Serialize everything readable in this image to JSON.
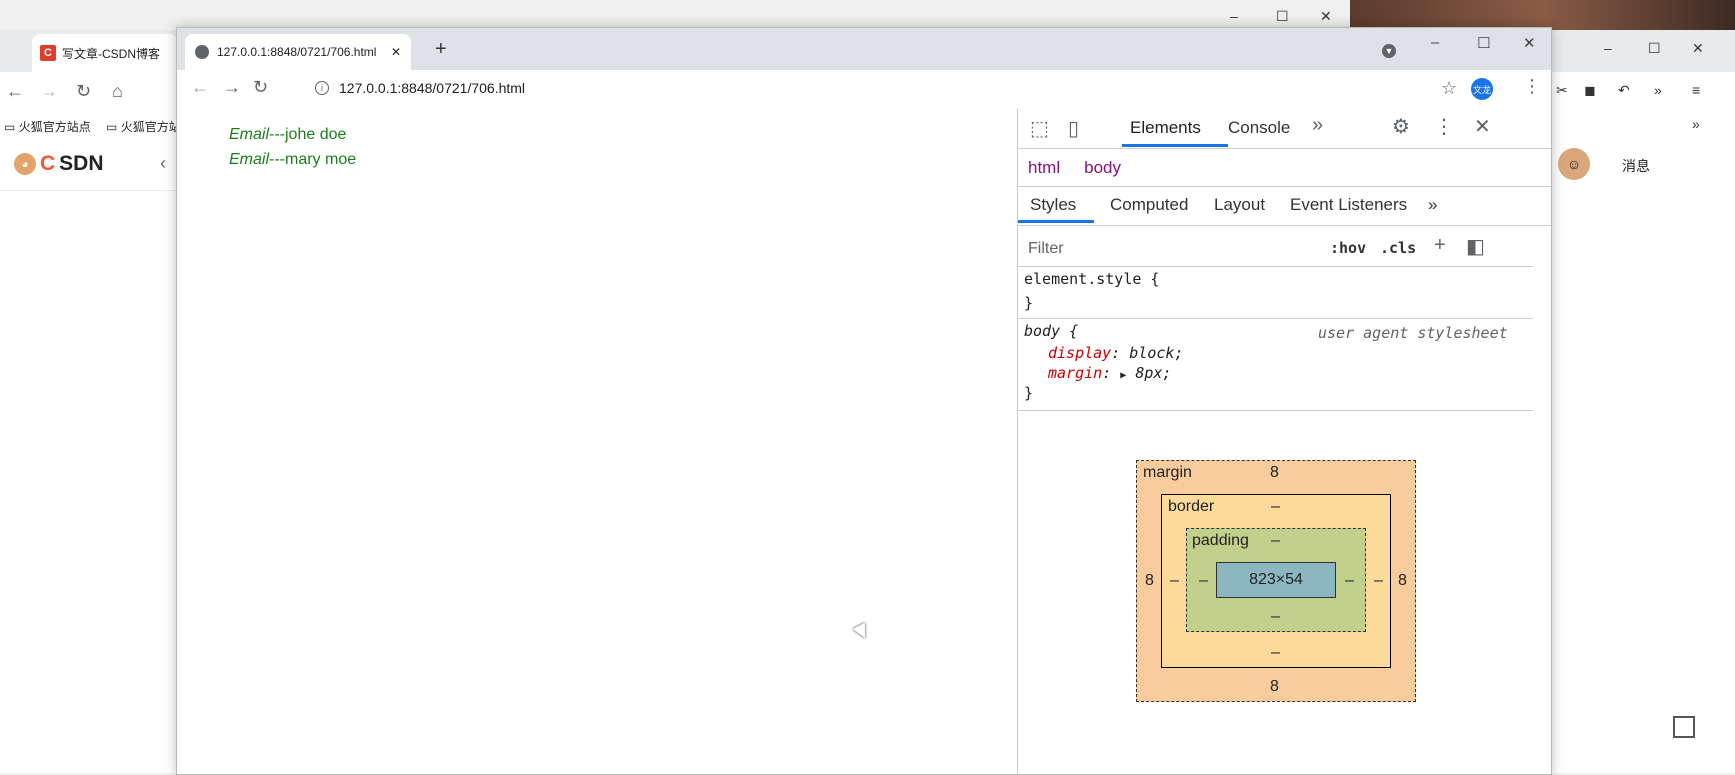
{
  "background_browser": {
    "tab_title": "写文章-CSDN博客",
    "tab_favicon": "C",
    "bookmarks": [
      "火狐官方站点",
      "火狐官方站"
    ],
    "logo": {
      "c": "C",
      "rest": "SDN"
    },
    "right": {
      "profile_initials": "文龙",
      "messages_label": "消息"
    }
  },
  "window": {
    "tab_title": "127.0.0.1:8848/0721/706.html",
    "new_tab": "+",
    "address": "127.0.0.1:8848/0721/706.html",
    "profile_initials": "文龙"
  },
  "page": {
    "lines": [
      {
        "label": "Email",
        "value": "---johe doe"
      },
      {
        "label": "Email",
        "value": "---mary moe"
      }
    ]
  },
  "devtools": {
    "main_tabs": [
      "Elements",
      "Console"
    ],
    "breadcrumbs": [
      "html",
      "body"
    ],
    "sub_tabs": [
      "Styles",
      "Computed",
      "Layout",
      "Event Listeners"
    ],
    "filter_placeholder": "Filter",
    "hov": ":hov",
    "cls": ".cls",
    "element_style_open": "element.style {",
    "close_brace": "}",
    "body_rule": "body {",
    "user_agent": "user agent stylesheet",
    "declarations": [
      {
        "prop": "display",
        "value": "block;"
      },
      {
        "prop": "margin",
        "value": "8px;"
      }
    ],
    "box_model": {
      "margin_label": "margin",
      "border_label": "border",
      "padding_label": "padding",
      "margin_top": "8",
      "margin_bottom": "8",
      "margin_left": "8",
      "margin_right": "8",
      "border_top": "–",
      "border_bottom": "–",
      "border_left": "–",
      "border_right": "–",
      "padding_top": "–",
      "padding_bottom": "–",
      "padding_left": "–",
      "padding_right": "–",
      "content": "823×54"
    }
  }
}
